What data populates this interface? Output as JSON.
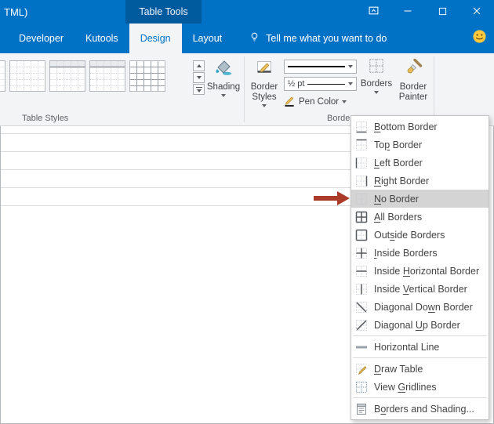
{
  "titlebar": {
    "title": "TML)",
    "contextual_tab": "Table Tools"
  },
  "tabs": {
    "items": [
      {
        "label": "Developer",
        "active": false
      },
      {
        "label": "Kutools",
        "active": false
      },
      {
        "label": "Design",
        "active": true
      },
      {
        "label": "Layout",
        "active": false
      }
    ],
    "tellme": "Tell me what you want to do"
  },
  "ribbon": {
    "shading_label": "Shading",
    "border_styles_label": "Border Styles",
    "line_weight_value": "½ pt",
    "pen_color_label": "Pen Color",
    "borders_button_label": "Borders",
    "border_painter_label": "Border Painter",
    "group_labels": {
      "table_styles": "Table Styles",
      "borders": "Borders"
    }
  },
  "menu": {
    "items": [
      {
        "label": "Bottom Border",
        "icon": "border-bottom",
        "accel_index": 0,
        "highlighted": false,
        "separator_after": false
      },
      {
        "label": "Top Border",
        "icon": "border-top",
        "accel_index": 2,
        "highlighted": false,
        "separator_after": false
      },
      {
        "label": "Left Border",
        "icon": "border-left",
        "accel_index": 0,
        "highlighted": false,
        "separator_after": false
      },
      {
        "label": "Right Border",
        "icon": "border-right",
        "accel_index": 0,
        "highlighted": false,
        "separator_after": false
      },
      {
        "label": "No Border",
        "icon": "border-none",
        "accel_index": 0,
        "highlighted": true,
        "separator_after": false
      },
      {
        "label": "All Borders",
        "icon": "border-all",
        "accel_index": 0,
        "highlighted": false,
        "separator_after": false
      },
      {
        "label": "Outside Borders",
        "icon": "border-outside",
        "accel_index": 3,
        "highlighted": false,
        "separator_after": false
      },
      {
        "label": "Inside Borders",
        "icon": "border-inside",
        "accel_index": 0,
        "highlighted": false,
        "separator_after": false
      },
      {
        "label": "Inside Horizontal Border",
        "icon": "border-inside-h",
        "accel_index": 7,
        "highlighted": false,
        "separator_after": false
      },
      {
        "label": "Inside Vertical Border",
        "icon": "border-inside-v",
        "accel_index": 7,
        "highlighted": false,
        "separator_after": false
      },
      {
        "label": "Diagonal Down Border",
        "icon": "border-diag-down",
        "accel_index": 11,
        "highlighted": false,
        "separator_after": false
      },
      {
        "label": "Diagonal Up Border",
        "icon": "border-diag-up",
        "accel_index": 9,
        "highlighted": false,
        "separator_after": true
      },
      {
        "label": "Horizontal Line",
        "icon": "horizontal-line",
        "accel_index": null,
        "highlighted": false,
        "separator_after": true
      },
      {
        "label": "Draw Table",
        "icon": "draw-table",
        "accel_index": 0,
        "highlighted": false,
        "separator_after": false
      },
      {
        "label": "View Gridlines",
        "icon": "view-gridlines",
        "accel_index": 5,
        "highlighted": false,
        "separator_after": true
      },
      {
        "label": "Borders and Shading...",
        "icon": "borders-shading-dialog",
        "accel_index": 1,
        "highlighted": false,
        "separator_after": false
      }
    ]
  },
  "icons": {
    "lightbulb-icon": "bulb outline",
    "smiley-icon": "smiley face",
    "ribbon-display-options-icon": "box with chevron",
    "minimize-icon": "—",
    "maximize-icon": "□",
    "close-icon": "✕",
    "shading-icon": "paint bucket",
    "border-styles-icon": "border sample with pen",
    "pen-color-icon": "pencil over color bar",
    "borders-icon": "dotted grid",
    "border-painter-icon": "paintbrush"
  },
  "colors": {
    "titlebar": "#0072C6",
    "contextual_tab": "#005A9E",
    "active_tab_text": "#0072C6",
    "ribbon_bg": "#F3F4F5",
    "menu_highlight": "#D4D4D4",
    "annotation_arrow": "#A93B28"
  }
}
